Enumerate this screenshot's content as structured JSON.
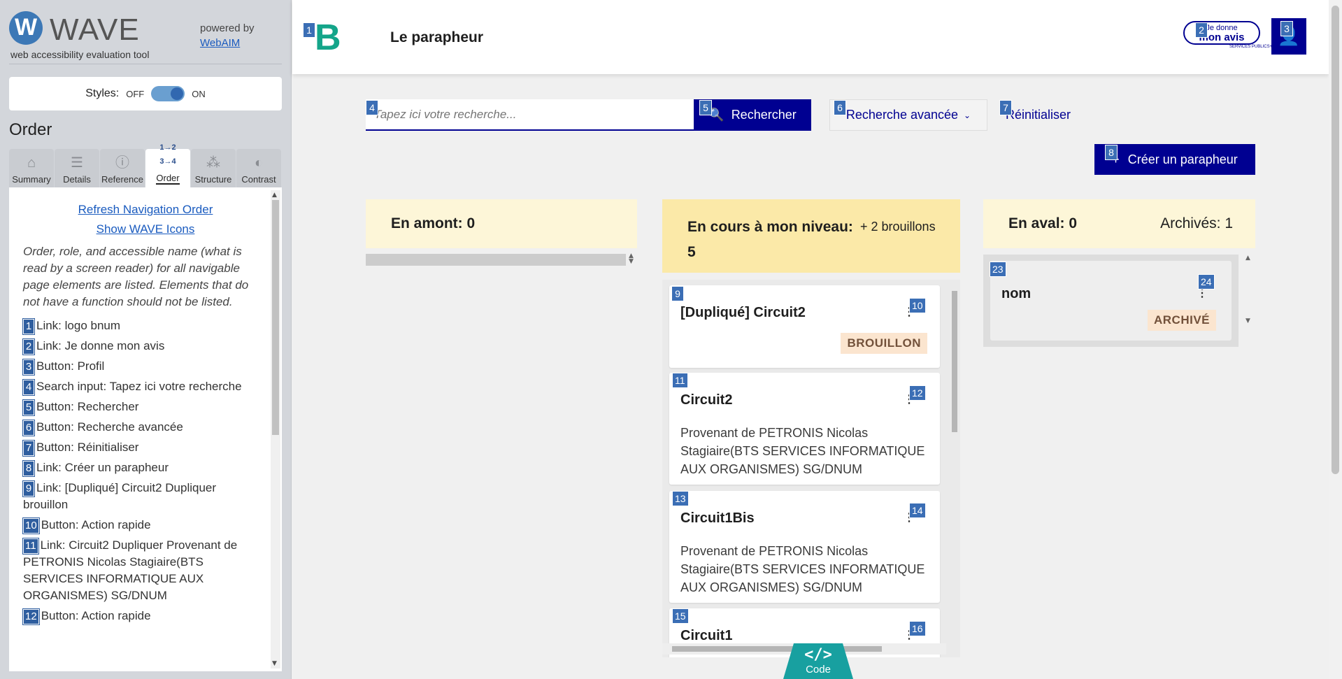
{
  "wave": {
    "logo_letter": "W",
    "name": "WAVE",
    "tagline": "web accessibility evaluation tool",
    "powered_by": "powered by",
    "webaim": "WebAIM",
    "styles_label": "Styles:",
    "styles_off": "OFF",
    "styles_on": "ON",
    "section_title": "Order",
    "tabs": [
      {
        "label": "Summary",
        "icon": "home-icon"
      },
      {
        "label": "Details",
        "icon": "list-icon"
      },
      {
        "label": "Reference",
        "icon": "info-icon"
      },
      {
        "label": "Order",
        "icon": "order-icon",
        "active": true
      },
      {
        "label": "Structure",
        "icon": "structure-icon"
      },
      {
        "label": "Contrast",
        "icon": "contrast-icon"
      }
    ],
    "refresh_link": "Refresh Navigation Order",
    "show_icons_link": "Show WAVE Icons",
    "description": "Order, role, and accessible name (what is read by a screen reader) for all navigable page elements are listed. Elements that do not have a function should not be listed.",
    "order_items": [
      {
        "num": "1",
        "text": "Link: logo bnum"
      },
      {
        "num": "2",
        "text": "Link: Je donne mon avis"
      },
      {
        "num": "3",
        "text": "Button: Profil"
      },
      {
        "num": "4",
        "text": "Search input: Tapez ici votre recherche"
      },
      {
        "num": "5",
        "text": "Button: Rechercher"
      },
      {
        "num": "6",
        "text": "Button: Recherche avancée"
      },
      {
        "num": "7",
        "text": "Button: Réinitialiser"
      },
      {
        "num": "8",
        "text": "Link: Créer un parapheur"
      },
      {
        "num": "9",
        "text": "Link: [Dupliqué] Circuit2 Dupliquer brouillon"
      },
      {
        "num": "10",
        "text": "Button: Action rapide"
      },
      {
        "num": "11",
        "text": "Link: Circuit2 Dupliquer Provenant de PETRONIS Nicolas Stagiaire(BTS SERVICES INFORMATIQUE AUX ORGANISMES) SG/DNUM"
      },
      {
        "num": "12",
        "text": "Button: Action rapide"
      }
    ]
  },
  "header": {
    "logo_letter": "B",
    "title": "Le parapheur",
    "avis_line1": "Je donne",
    "avis_line2": "mon avis",
    "avis_sub": "SERVICES PUBLICS+",
    "profile_icon": "user-icon"
  },
  "search": {
    "placeholder": "Tapez ici votre recherche...",
    "button": "Rechercher",
    "advanced": "Recherche avancée",
    "reset": "Réinitialiser",
    "create": "Créer un parapheur"
  },
  "columns": {
    "amont": "En amont: 0",
    "cours_title": "En cours à mon niveau: 5",
    "cours_extra": "+ 2 brouillons",
    "aval": "En aval: 0",
    "archives": "Archivés: 1"
  },
  "cards": [
    {
      "title": "[Dupliqué] Circuit2",
      "tag": "BROUILLON",
      "desc": ""
    },
    {
      "title": "Circuit2",
      "tag": "",
      "desc": "Provenant de PETRONIS Nicolas Stagiaire(BTS SERVICES INFORMATIQUE AUX ORGANISMES) SG/DNUM"
    },
    {
      "title": "Circuit1Bis",
      "tag": "",
      "desc": "Provenant de PETRONIS Nicolas Stagiaire(BTS SERVICES INFORMATIQUE AUX ORGANISMES) SG/DNUM"
    },
    {
      "title": "Circuit1",
      "tag": "",
      "desc": ""
    }
  ],
  "aval_card": {
    "title": "nom",
    "tag": "ARCHIVÉ"
  },
  "badges": [
    "1",
    "2",
    "3",
    "4",
    "5",
    "6",
    "7",
    "8",
    "9",
    "10",
    "11",
    "12",
    "13",
    "14",
    "15",
    "16",
    "23",
    "24"
  ],
  "code_button": {
    "glyph": "</>",
    "label": "Code"
  }
}
